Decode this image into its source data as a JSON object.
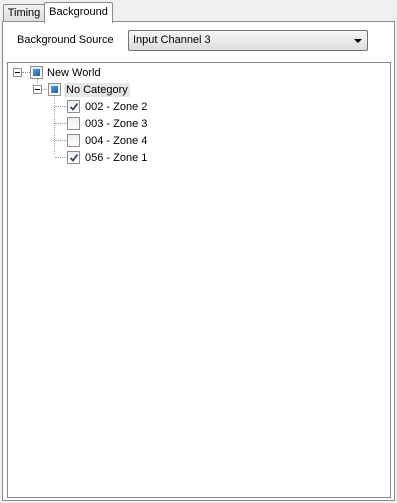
{
  "tabs": [
    {
      "label": "Timing",
      "active": false
    },
    {
      "label": "Background",
      "active": true
    }
  ],
  "background_source": {
    "label": "Background Source",
    "selected": "Input Channel 3"
  },
  "tree": {
    "root": {
      "label": "New World",
      "state": "indeterminate",
      "expanded": true
    },
    "category": {
      "label": "No Category",
      "state": "indeterminate",
      "expanded": true
    },
    "zones": [
      {
        "label": "002 - Zone 2",
        "checked": true
      },
      {
        "label": "003 - Zone 3",
        "checked": false
      },
      {
        "label": "004 - Zone 4",
        "checked": false
      },
      {
        "label": "056 - Zone 1",
        "checked": true
      }
    ]
  },
  "colors": {
    "tri_state_fill": "#2f7fd0",
    "selection_highlight": "#e6e6e6",
    "border": "#898c95"
  }
}
